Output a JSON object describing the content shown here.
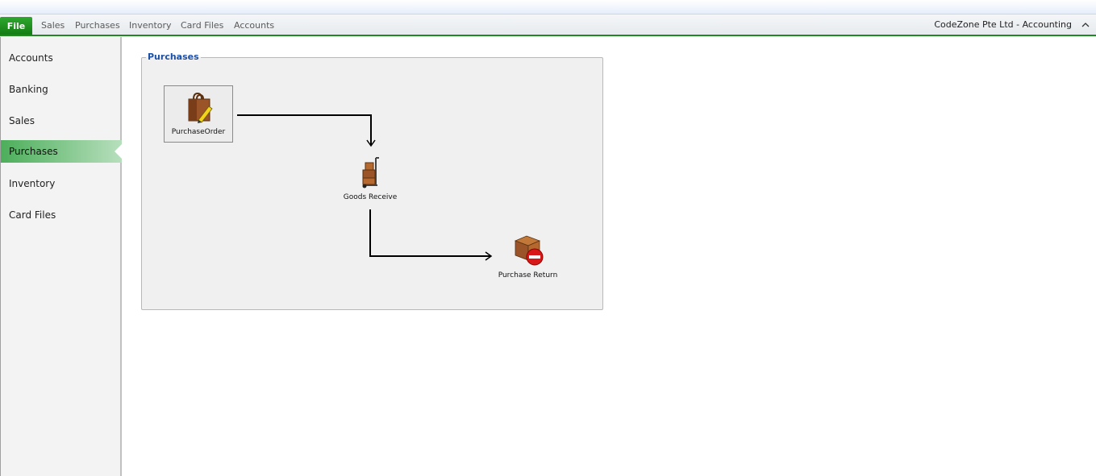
{
  "menu": {
    "file_label": "File",
    "tabs": [
      "Sales",
      "Purchases",
      "Inventory",
      "Card Files",
      "Accounts"
    ],
    "app_title": "CodeZone Pte Ltd - Accounting"
  },
  "sidebar": {
    "items": [
      {
        "label": "Accounts",
        "active": false
      },
      {
        "label": "Banking",
        "active": false
      },
      {
        "label": "Sales",
        "active": false
      },
      {
        "label": "Purchases",
        "active": true
      },
      {
        "label": "Inventory",
        "active": false
      },
      {
        "label": "Card Files",
        "active": false
      }
    ]
  },
  "workflow": {
    "group_title": "Purchases",
    "nodes": [
      {
        "label": "PurchaseOrder",
        "icon": "shopping-bag-pencil-icon"
      },
      {
        "label": "Goods Receive",
        "icon": "hand-truck-boxes-icon"
      },
      {
        "label": "Purchase Return",
        "icon": "box-no-entry-icon"
      }
    ]
  },
  "colors": {
    "accent_green": "#1f8a1f",
    "legend_blue": "#1d4fa3"
  }
}
